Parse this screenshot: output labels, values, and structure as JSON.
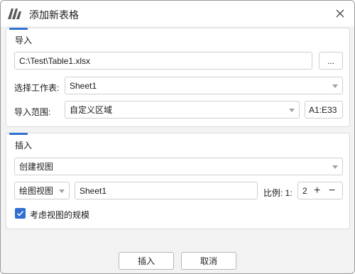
{
  "window": {
    "title": "添加新表格",
    "logo_icon": "app-logo-icon",
    "close_icon": "close-icon"
  },
  "import_group": {
    "title": "导入",
    "file_path": "C:\\Test\\Table1.xlsx",
    "browse_label": "...",
    "sheet_label": "选择工作表:",
    "sheet_value": "Sheet1",
    "range_label": "导入范围:",
    "range_mode": "自定义区域",
    "range_value": "A1:E33"
  },
  "insert_group": {
    "title": "插入",
    "insert_mode": "创建视图",
    "view_type": "绘图视图",
    "view_sheet": "Sheet1",
    "scale_label": "比例: 1:",
    "scale_value": "2",
    "consider_scale_label": "考虑视图的规模",
    "consider_scale_checked": true
  },
  "footer": {
    "ok_label": "插入",
    "cancel_label": "取消"
  },
  "colors": {
    "accent": "#2f6fd1",
    "background": "#f3f3f3"
  }
}
